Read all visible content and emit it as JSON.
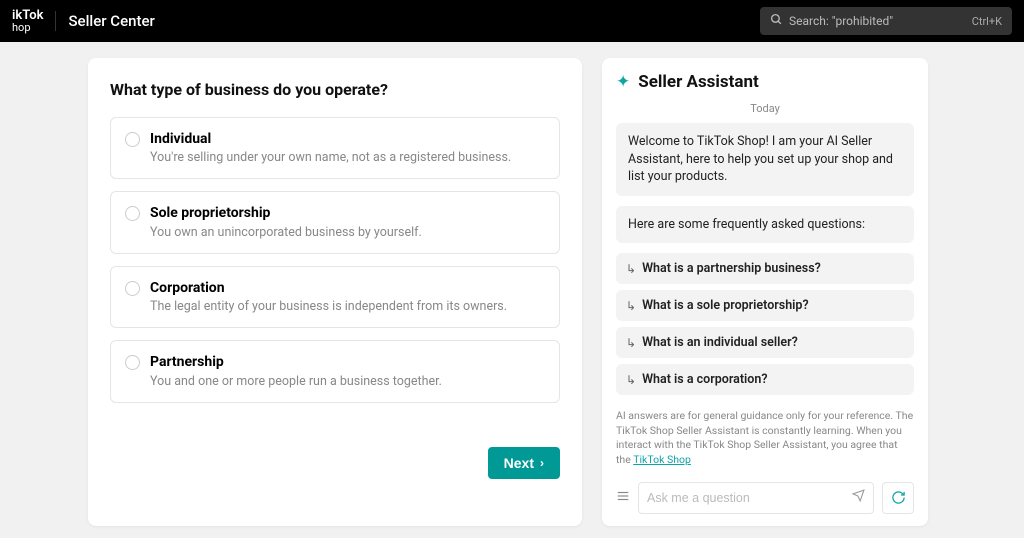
{
  "header": {
    "logo_line1": "ikTok",
    "logo_line2": "hop",
    "title": "Seller Center",
    "search_placeholder": "Search: \"prohibited\"",
    "search_shortcut": "Ctrl+K"
  },
  "form": {
    "question": "What type of business do you operate?",
    "options": [
      {
        "title": "Individual",
        "desc": "You're selling under your own name, not as a registered business."
      },
      {
        "title": "Sole proprietorship",
        "desc": "You own an unincorporated business by yourself."
      },
      {
        "title": "Corporation",
        "desc": "The legal entity of your business is independent from its owners."
      },
      {
        "title": "Partnership",
        "desc": "You and one or more people run a business together."
      }
    ],
    "next_label": "Next"
  },
  "assistant": {
    "title": "Seller Assistant",
    "date": "Today",
    "welcome": "Welcome to TikTok Shop! I am your AI Seller Assistant, here to help you set up your shop and list your products.",
    "faq_intro": "Here are some frequently asked questions:",
    "faqs": [
      "What is a partnership business?",
      "What is a sole proprietorship?",
      "What is an individual seller?",
      "What is a corporation?"
    ],
    "disclaimer_prefix": "AI answers are for general guidance only for your reference. The TikTok Shop Seller Assistant is constantly learning. When you interact with the TikTok Shop Seller Assistant, you agree that the ",
    "disclaimer_link": "TikTok Shop",
    "input_placeholder": "Ask me a question"
  }
}
